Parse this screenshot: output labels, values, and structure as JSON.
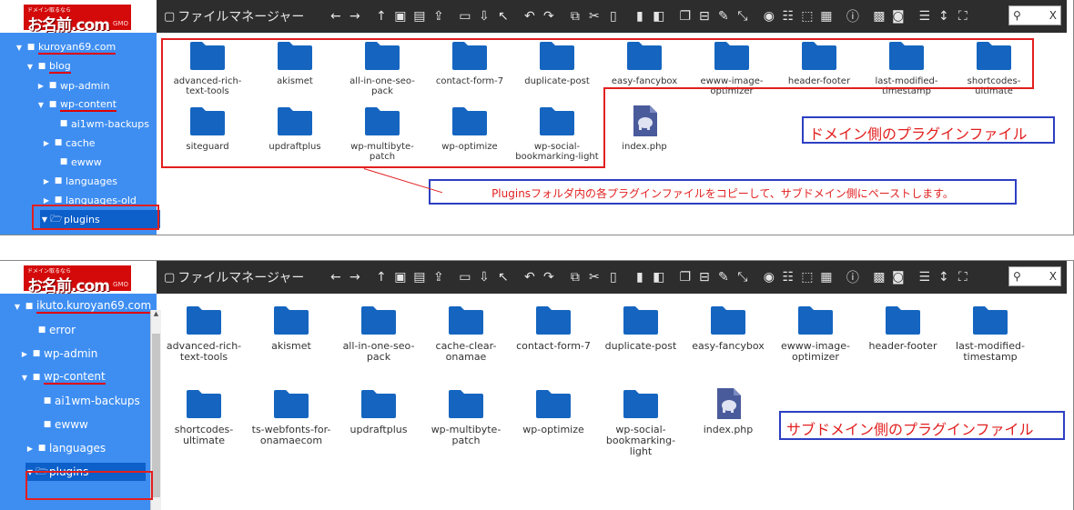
{
  "top": {
    "logo": {
      "small": "ドメイン取るなら",
      "big": "お名前.com",
      "gmo": "GMO"
    },
    "toolbar": {
      "title": "ファイルマネージャー",
      "search_placeholder": "",
      "search_close": "X"
    },
    "tree": [
      {
        "label": "kuroyan69.com",
        "arrow": "▼",
        "underline": true
      },
      {
        "label": "blog",
        "arrow": "▼",
        "underline": true
      },
      {
        "label": "wp-admin",
        "arrow": "▶",
        "underline": false
      },
      {
        "label": "wp-content",
        "arrow": "▼",
        "underline": true
      },
      {
        "label": "ai1wm-backups",
        "arrow": "",
        "underline": false
      },
      {
        "label": "cache",
        "arrow": "▶",
        "underline": false
      },
      {
        "label": "ewww",
        "arrow": "",
        "underline": false
      },
      {
        "label": "languages",
        "arrow": "▶",
        "underline": false
      },
      {
        "label": "languages-old",
        "arrow": "▶",
        "underline": false
      },
      {
        "label": "plugins",
        "arrow": "▼",
        "underline": false,
        "selected": true
      }
    ],
    "files": [
      {
        "label": "advanced-rich-text-tools",
        "type": "folder"
      },
      {
        "label": "akismet",
        "type": "folder"
      },
      {
        "label": "all-in-one-seo-pack",
        "type": "folder"
      },
      {
        "label": "contact-form-7",
        "type": "folder"
      },
      {
        "label": "duplicate-post",
        "type": "folder"
      },
      {
        "label": "easy-fancybox",
        "type": "folder"
      },
      {
        "label": "ewww-image-optimizer",
        "type": "folder"
      },
      {
        "label": "header-footer",
        "type": "folder"
      },
      {
        "label": "last-modified-timestamp",
        "type": "folder"
      },
      {
        "label": "shortcodes-ultimate",
        "type": "folder"
      },
      {
        "label": "siteguard",
        "type": "folder"
      },
      {
        "label": "updraftplus",
        "type": "folder"
      },
      {
        "label": "wp-multibyte-patch",
        "type": "folder"
      },
      {
        "label": "wp-optimize",
        "type": "folder"
      },
      {
        "label": "wp-social-bookmarking-light",
        "type": "folder"
      },
      {
        "label": "index.php",
        "type": "php"
      }
    ],
    "annotation_domain": "ドメイン側のプラグインファイル",
    "annotation_copy": "Pluginsフォルダ内の各プラグインファイルをコピーして、サブドメイン側にペーストします。"
  },
  "bottom": {
    "logo": {
      "small": "ドメイン取るなら",
      "big": "お名前.com",
      "gmo": "GMO"
    },
    "toolbar": {
      "title": "ファイルマネージャー",
      "search_placeholder": "",
      "search_close": "X"
    },
    "tree": [
      {
        "label": "ikuto.kuroyan69.com",
        "arrow": "▼",
        "underline": true
      },
      {
        "label": "error",
        "arrow": "",
        "underline": false
      },
      {
        "label": "wp-admin",
        "arrow": "▶",
        "underline": false
      },
      {
        "label": "wp-content",
        "arrow": "▼",
        "underline": true
      },
      {
        "label": "ai1wm-backups",
        "arrow": "",
        "underline": false
      },
      {
        "label": "ewww",
        "arrow": "",
        "underline": false
      },
      {
        "label": "languages",
        "arrow": "▶",
        "underline": false
      },
      {
        "label": "plugins",
        "arrow": "▼",
        "underline": false,
        "selected": true
      }
    ],
    "files": [
      {
        "label": "advanced-rich-text-tools",
        "type": "folder"
      },
      {
        "label": "akismet",
        "type": "folder"
      },
      {
        "label": "all-in-one-seo-pack",
        "type": "folder"
      },
      {
        "label": "cache-clear-onamae",
        "type": "folder"
      },
      {
        "label": "contact-form-7",
        "type": "folder"
      },
      {
        "label": "duplicate-post",
        "type": "folder"
      },
      {
        "label": "easy-fancybox",
        "type": "folder"
      },
      {
        "label": "ewww-image-optimizer",
        "type": "folder"
      },
      {
        "label": "header-footer",
        "type": "folder"
      },
      {
        "label": "last-modified-timestamp",
        "type": "folder"
      },
      {
        "label": "shortcodes-ultimate",
        "type": "folder"
      },
      {
        "label": "ts-webfonts-for-onamaecom",
        "type": "folder"
      },
      {
        "label": "updraftplus",
        "type": "folder"
      },
      {
        "label": "wp-multibyte-patch",
        "type": "folder"
      },
      {
        "label": "wp-optimize",
        "type": "folder"
      },
      {
        "label": "wp-social-bookmarking-light",
        "type": "folder"
      },
      {
        "label": "index.php",
        "type": "php"
      }
    ],
    "annotation_subdomain": "サブドメイン側のプラグインファイル"
  },
  "toolbar_icons": [
    "arrow-left-icon",
    "arrow-right-icon",
    "arrow-up-icon",
    "new-file-icon",
    "new-folder-icon",
    "upload-icon",
    "select-icon",
    "download-icon",
    "pointer-icon",
    "undo-icon",
    "redo-icon",
    "copy-icon",
    "cut-icon",
    "paste-icon",
    "delete-icon",
    "empty-icon",
    "duplicate-icon",
    "rename-icon",
    "edit-icon",
    "resize-icon",
    "view-icon",
    "select-all-icon",
    "select-none-icon",
    "invert-select-icon",
    "info-icon",
    "archive-icon",
    "extract-icon",
    "list-view-icon",
    "sort-icon",
    "fullscreen-icon"
  ],
  "colors": {
    "sidebar": "#3e8ef2",
    "selected": "#0d5fc9",
    "toolbar": "#2d2d2d",
    "folder": "#1565c0",
    "annotation_red": "#e21f1f",
    "annotation_blue": "#2d3fc2"
  }
}
